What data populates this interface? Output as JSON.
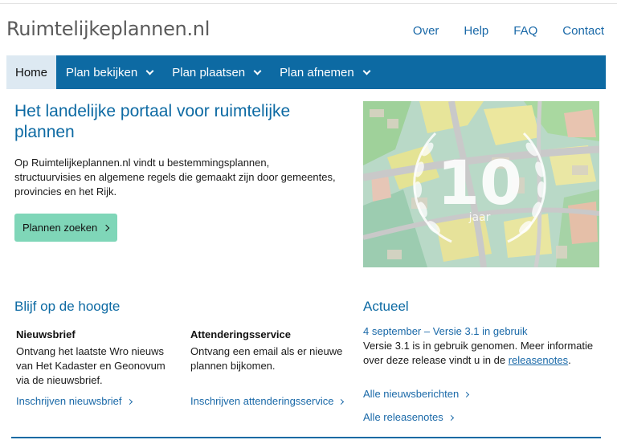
{
  "header": {
    "logo": "Ruimtelijkeplannen.nl",
    "links": [
      "Over",
      "Help",
      "FAQ",
      "Contact"
    ]
  },
  "nav": {
    "items": [
      "Home",
      "Plan bekijken",
      "Plan plaatsen",
      "Plan afnemen"
    ]
  },
  "hero": {
    "title": "Het landelijke portaal voor ruimtelijke plannen",
    "text": "Op Ruimtelijkeplannen.nl vindt u bestemmingsplannen, structuurvisies en algemene regels die gemaakt zijn door gemeentes, provincies en het Rijk.",
    "button": "Plannen zoeken",
    "badge_number": "10",
    "badge_unit": "jaar"
  },
  "stay_updated": {
    "heading": "Blijf op de hoogte",
    "newsletter": {
      "title": "Nieuwsbrief",
      "text": "Ontvang het laatste Wro nieuws van Het Kadaster en Geonovum via de nieuwsbrief.",
      "link": "Inschrijven nieuwsbrief"
    },
    "alert": {
      "title": "Attenderingsservice",
      "text": "Ontvang een email als er nieuwe plannen bijkomen.",
      "link": "Inschrijven attenderingsservice"
    }
  },
  "news": {
    "heading": "Actueel",
    "item_title": "4 september – Versie 3.1 in gebruik",
    "item_text": "Versie 3.1 is in gebruik genomen. Meer informatie over deze release vindt u in de",
    "item_link": "releasenotes",
    "all_news": "Alle nieuwsberichten",
    "all_releases": "Alle releasenotes"
  },
  "colors": {
    "brand_blue": "#0d6aa3",
    "button_green": "#7fd6b8",
    "active_nav": "#dde9f2"
  }
}
